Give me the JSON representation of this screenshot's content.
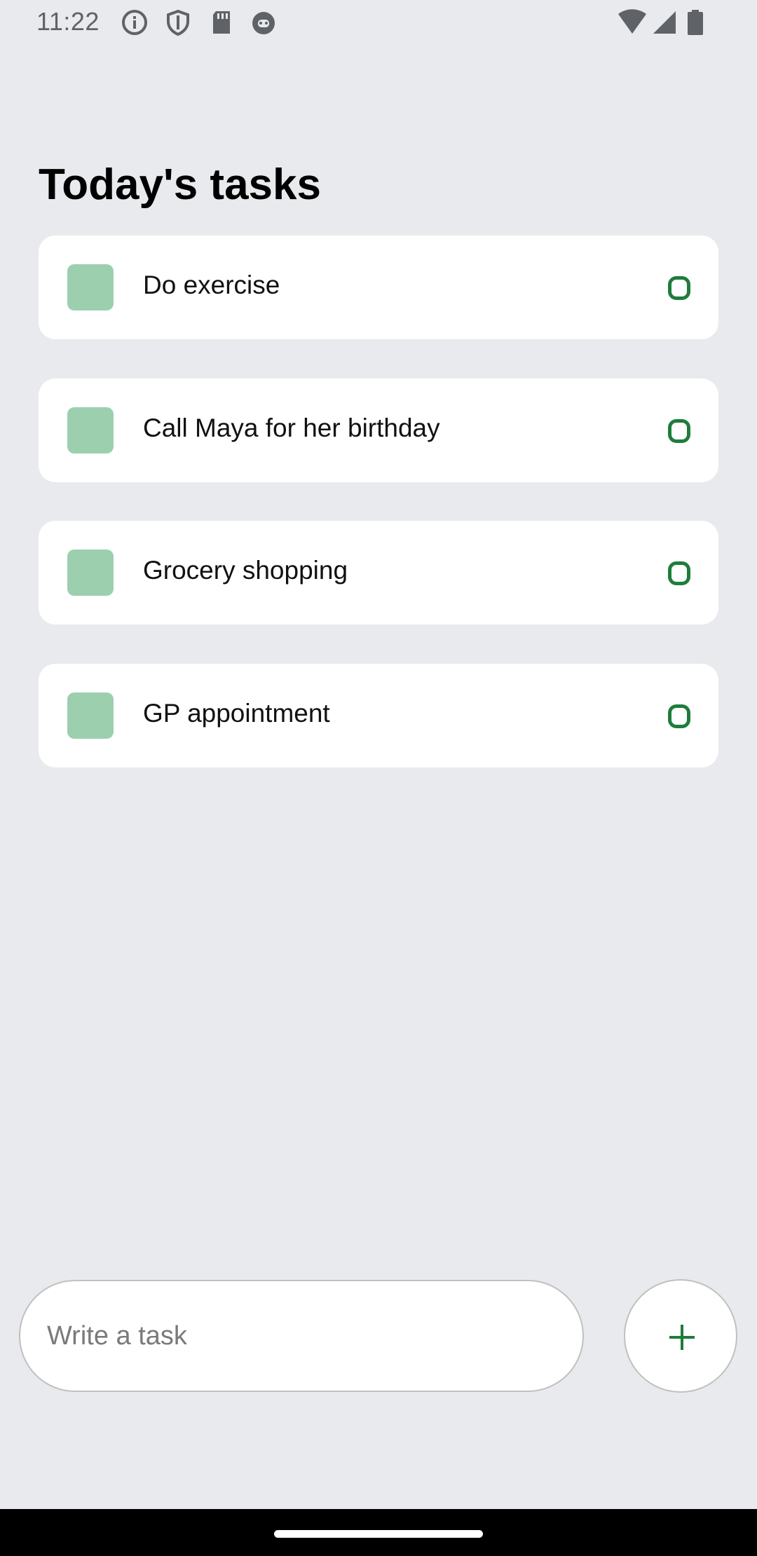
{
  "status_bar": {
    "time": "11:22",
    "left_icons": [
      "info-icon",
      "shield-icon",
      "sd-card-icon",
      "robot-face-icon"
    ],
    "right_icons": [
      "wifi-icon",
      "cellular-signal-icon",
      "battery-icon"
    ]
  },
  "page": {
    "title": "Today's tasks"
  },
  "tasks": [
    {
      "label": "Do exercise"
    },
    {
      "label": "Call Maya for her birthday"
    },
    {
      "label": "Grocery shopping"
    },
    {
      "label": "GP appointment"
    }
  ],
  "composer": {
    "placeholder": "Write a task",
    "add_icon": "plus-icon"
  },
  "colors": {
    "background": "#e8eaed",
    "card": "#ffffff",
    "task_square": "#9ccfae",
    "accent_green": "#1e7d3b"
  }
}
